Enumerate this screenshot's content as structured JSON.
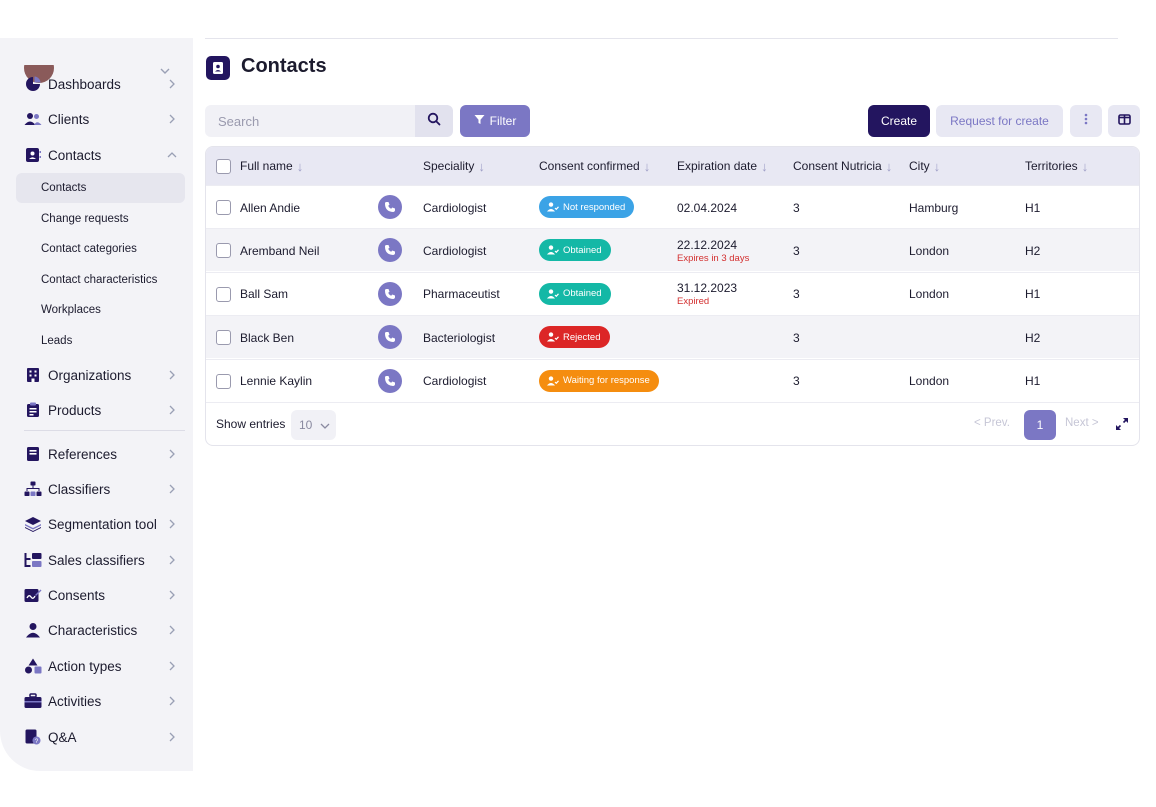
{
  "colors": {
    "primary_dark": "#23155f",
    "primary": "#7b77c4",
    "sidebar_bg": "#f3f3f7",
    "header_bg": "#e8e8f3",
    "badge_not_responded": "#3ba3e6",
    "badge_obtained": "#14b8a6",
    "badge_rejected": "#dc2626",
    "badge_waiting": "#f58d0f",
    "expired_text": "#d32f2f"
  },
  "sidebar": {
    "items": [
      {
        "label": "Dashboards",
        "icon": "pie-chart-icon"
      },
      {
        "label": "Clients",
        "icon": "users-icon"
      },
      {
        "label": "Contacts",
        "icon": "contact-card-icon",
        "expanded": true
      },
      {
        "label": "Organizations",
        "icon": "building-icon"
      },
      {
        "label": "Products",
        "icon": "clipboard-icon"
      },
      {
        "label": "References",
        "icon": "book-icon"
      },
      {
        "label": "Classifiers",
        "icon": "hierarchy-icon"
      },
      {
        "label": "Segmentation tool",
        "icon": "layers-icon"
      },
      {
        "label": "Sales classifiers",
        "icon": "folders-icon"
      },
      {
        "label": "Consents",
        "icon": "signature-icon"
      },
      {
        "label": "Characteristics",
        "icon": "person-icon"
      },
      {
        "label": "Action types",
        "icon": "shapes-icon"
      },
      {
        "label": "Activities",
        "icon": "briefcase-icon"
      },
      {
        "label": "Q&A",
        "icon": "question-doc-icon"
      }
    ],
    "sub_items": [
      {
        "label": "Contacts",
        "active": true
      },
      {
        "label": "Change requests"
      },
      {
        "label": "Contact categories"
      },
      {
        "label": "Contact characteristics"
      },
      {
        "label": "Workplaces"
      },
      {
        "label": "Leads"
      }
    ]
  },
  "header": {
    "title": "Contacts"
  },
  "toolbar": {
    "search_placeholder": "Search",
    "filter_label": "Filter",
    "create_label": "Create",
    "request_label": "Request for create"
  },
  "table": {
    "columns": [
      "Full name",
      "Speciality",
      "Consent confirmed",
      "Expiration date",
      "Consent Nutricia",
      "City",
      "Territories"
    ],
    "rows": [
      {
        "name": "Allen Andie",
        "speciality": "Cardiologist",
        "consent": "Not responded",
        "consent_type": "not_responded",
        "expiration": "02.04.2024",
        "expiration_note": "",
        "nutricia": "3",
        "city": "Hamburg",
        "territory": "H1"
      },
      {
        "name": "Aremband Neil",
        "speciality": "Cardiologist",
        "consent": "Obtained",
        "consent_type": "obtained",
        "expiration": "22.12.2024",
        "expiration_note": "Expires in 3 days",
        "nutricia": "3",
        "city": "London",
        "territory": "H2"
      },
      {
        "name": "Ball Sam",
        "speciality": "Pharmaceutist",
        "consent": "Obtained",
        "consent_type": "obtained",
        "expiration": "31.12.2023",
        "expiration_note": "Expired",
        "nutricia": "3",
        "city": "London",
        "territory": "H1"
      },
      {
        "name": "Black Ben",
        "speciality": "Bacteriologist",
        "consent": "Rejected",
        "consent_type": "rejected",
        "expiration": "",
        "expiration_note": "",
        "nutricia": "3",
        "city": "",
        "territory": "H2"
      },
      {
        "name": "Lennie Kaylin",
        "speciality": "Cardiologist",
        "consent": "Waiting for response",
        "consent_type": "waiting",
        "expiration": "",
        "expiration_note": "",
        "nutricia": "3",
        "city": "London",
        "territory": "H1"
      }
    ]
  },
  "pagination": {
    "show_entries_label": "Show entries",
    "entries_value": "10",
    "prev_label": "< Prev.",
    "current_page": "1",
    "next_label": "Next >"
  }
}
